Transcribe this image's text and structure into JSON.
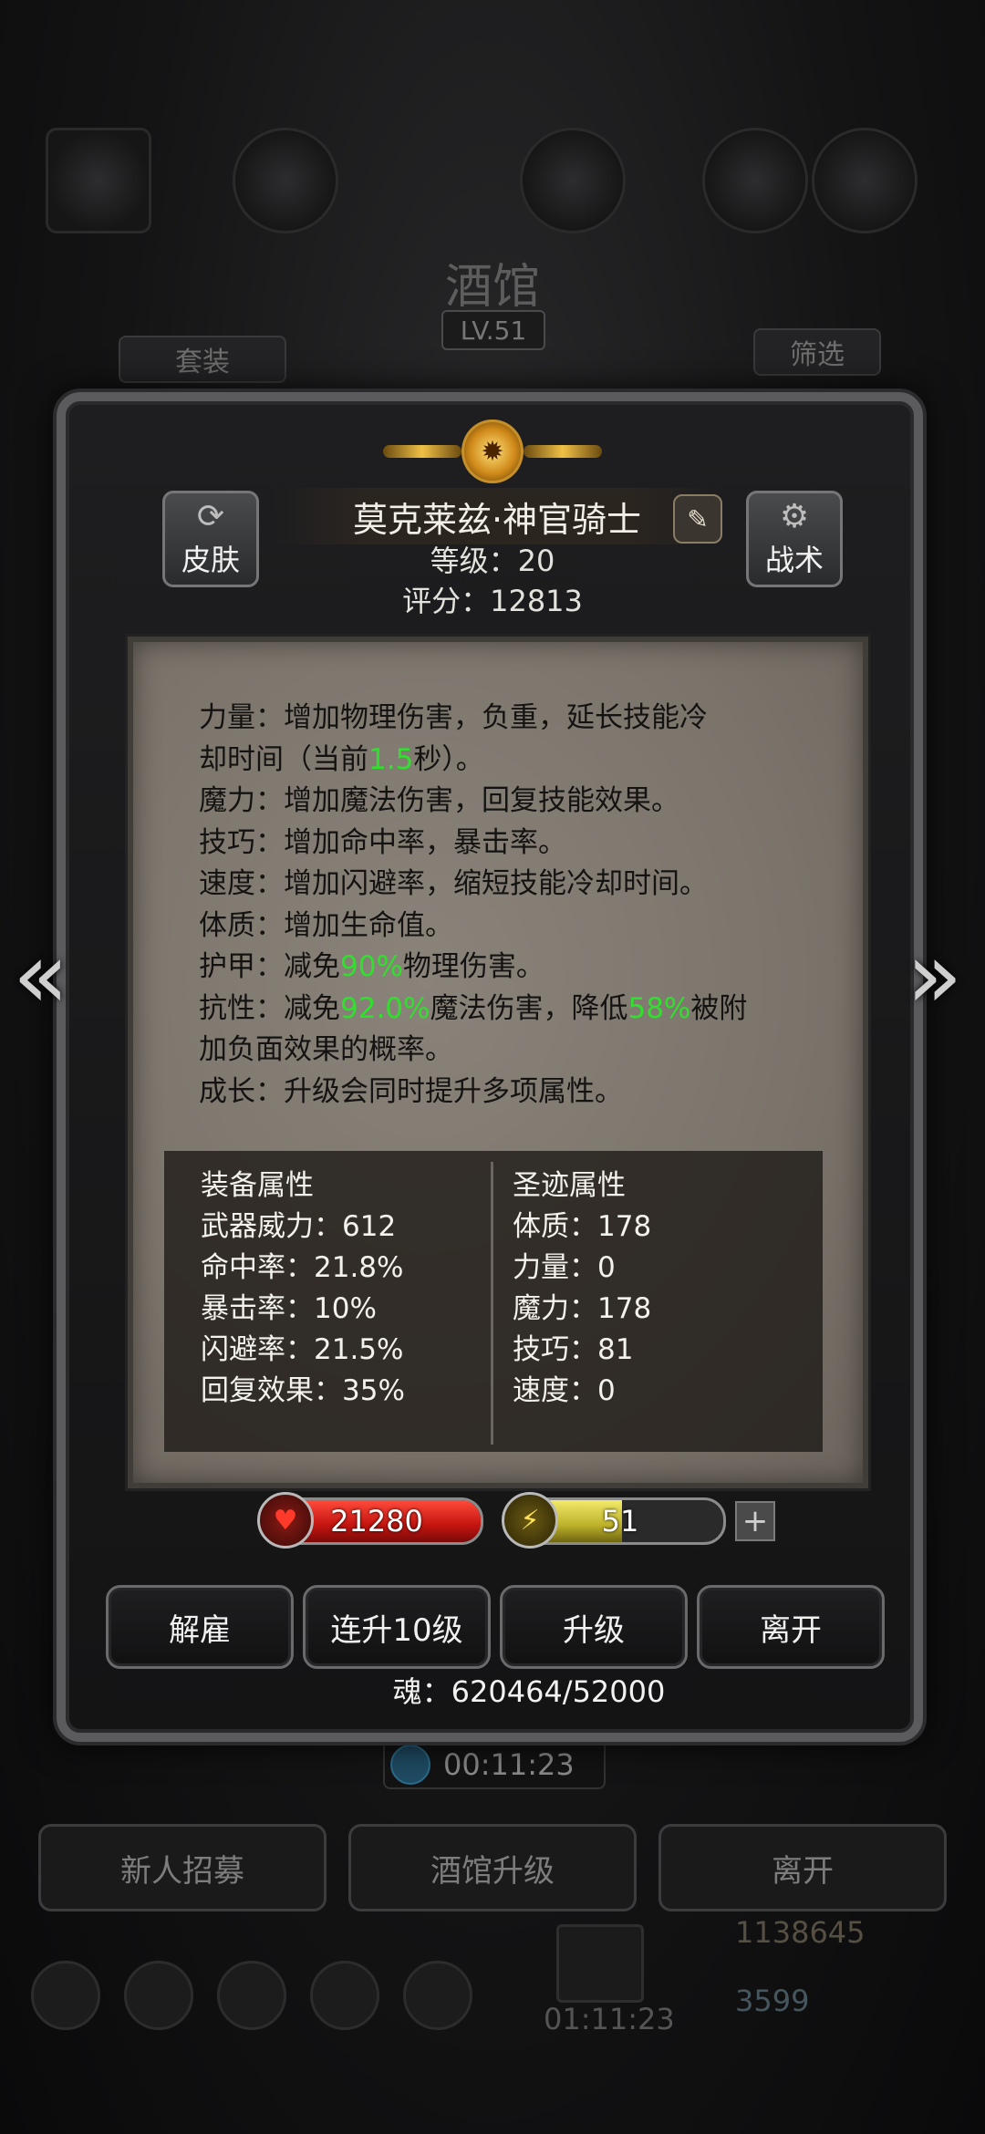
{
  "background": {
    "title": "酒馆",
    "level": "LV.51",
    "tab_left": "套装",
    "tab_right": "筛选",
    "timer": "00:11:23",
    "buttons": [
      "新人招募",
      "酒馆升级",
      "离开"
    ],
    "gold": "1138645",
    "gems": "3599",
    "chest_timer": "01:11:23"
  },
  "hero": {
    "name": "莫克莱兹·神官骑士",
    "level_text": "等级：20",
    "score_text": "评分：12813",
    "skin_label": "皮肤",
    "tactic_label": "战术"
  },
  "description": {
    "lines": [
      {
        "pre": "力量：增加物理伤害，负重，延长技能冷",
        "hl": "",
        "post": ""
      },
      {
        "pre": "却时间（当前",
        "hl": "1.5",
        "post": "秒）。"
      },
      {
        "pre": "魔力：增加魔法伤害，回复技能效果。",
        "hl": "",
        "post": ""
      },
      {
        "pre": "技巧：增加命中率，暴击率。",
        "hl": "",
        "post": ""
      },
      {
        "pre": "速度：增加闪避率，缩短技能冷却时间。",
        "hl": "",
        "post": ""
      },
      {
        "pre": "体质：增加生命值。",
        "hl": "",
        "post": ""
      },
      {
        "pre": "护甲：减免",
        "hl": "90%",
        "post": "物理伤害。"
      },
      {
        "pre": "抗性：减免",
        "hl": "92.0%",
        "post": "魔法伤害，降低",
        "hl2": "58%",
        "post2": "被附"
      },
      {
        "pre": "加负面效果的概率。",
        "hl": "",
        "post": ""
      },
      {
        "pre": "成长：升级会同时提升多项属性。",
        "hl": "",
        "post": ""
      }
    ]
  },
  "equipment": {
    "title": "装备属性",
    "rows": [
      "武器威力：612",
      "命中率：21.8%",
      "暴击率：10%",
      "闪避率：21.5%",
      "回复效果：35%"
    ]
  },
  "relic": {
    "title": "圣迹属性",
    "rows": [
      "体质：178",
      "力量：0",
      "魔力：178",
      "技巧：81",
      "速度：0"
    ]
  },
  "bars": {
    "hp": "21280",
    "hp_fill": 1.0,
    "energy": "51",
    "energy_fill": 0.51
  },
  "actions": [
    "解雇",
    "连升10级",
    "升级",
    "离开"
  ],
  "soul": "魂：620464/52000",
  "colors": {
    "highlight": "#2fe02c",
    "hp": "#c3140f",
    "energy": "#bdb12a"
  }
}
